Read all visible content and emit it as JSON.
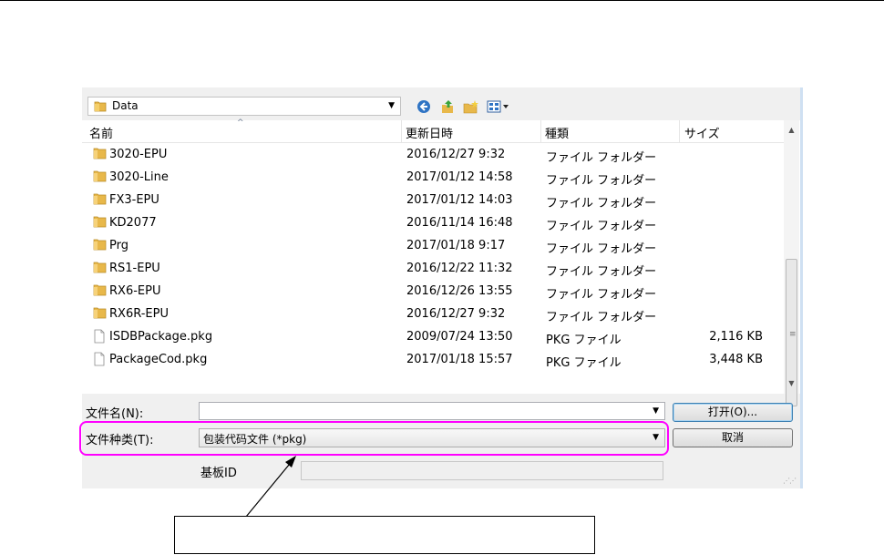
{
  "path_bar": {
    "current_folder": "Data"
  },
  "columns": {
    "name": "名前",
    "date": "更新日時",
    "type": "種類",
    "size": "サイズ"
  },
  "files": [
    {
      "kind": "folder",
      "name": "3020-EPU",
      "date": "2016/12/27 9:32",
      "type": "ファイル フォルダー",
      "size": ""
    },
    {
      "kind": "folder",
      "name": "3020-Line",
      "date": "2017/01/12 14:58",
      "type": "ファイル フォルダー",
      "size": ""
    },
    {
      "kind": "folder",
      "name": "FX3-EPU",
      "date": "2017/01/12 14:03",
      "type": "ファイル フォルダー",
      "size": ""
    },
    {
      "kind": "folder",
      "name": "KD2077",
      "date": "2016/11/14 16:48",
      "type": "ファイル フォルダー",
      "size": ""
    },
    {
      "kind": "folder",
      "name": "Prg",
      "date": "2017/01/18 9:17",
      "type": "ファイル フォルダー",
      "size": ""
    },
    {
      "kind": "folder",
      "name": "RS1-EPU",
      "date": "2016/12/22 11:32",
      "type": "ファイル フォルダー",
      "size": ""
    },
    {
      "kind": "folder",
      "name": "RX6-EPU",
      "date": "2016/12/26 13:55",
      "type": "ファイル フォルダー",
      "size": ""
    },
    {
      "kind": "folder",
      "name": "RX6R-EPU",
      "date": "2016/12/27 9:32",
      "type": "ファイル フォルダー",
      "size": ""
    },
    {
      "kind": "file",
      "name": "ISDBPackage.pkg",
      "date": "2009/07/24 13:50",
      "type": "PKG ファイル",
      "size": "2,116 KB"
    },
    {
      "kind": "file",
      "name": "PackageCod.pkg",
      "date": "2017/01/18 15:57",
      "type": "PKG ファイル",
      "size": "3,448 KB"
    }
  ],
  "form": {
    "filename_label": "文件名(N):",
    "filename_value": "",
    "filetype_label": "文件种类(T):",
    "filetype_value": "包装代码文件 (*pkg)",
    "board_id_label": "基板ID",
    "board_id_value": ""
  },
  "buttons": {
    "open": "打开(O)...",
    "cancel": "取消"
  },
  "colors": {
    "highlight": "#ff00ff",
    "folder": "#e8b84a"
  },
  "icons": [
    "back-icon",
    "up-folder-icon",
    "new-folder-icon",
    "view-menu-icon",
    "folder-icon",
    "file-icon"
  ]
}
